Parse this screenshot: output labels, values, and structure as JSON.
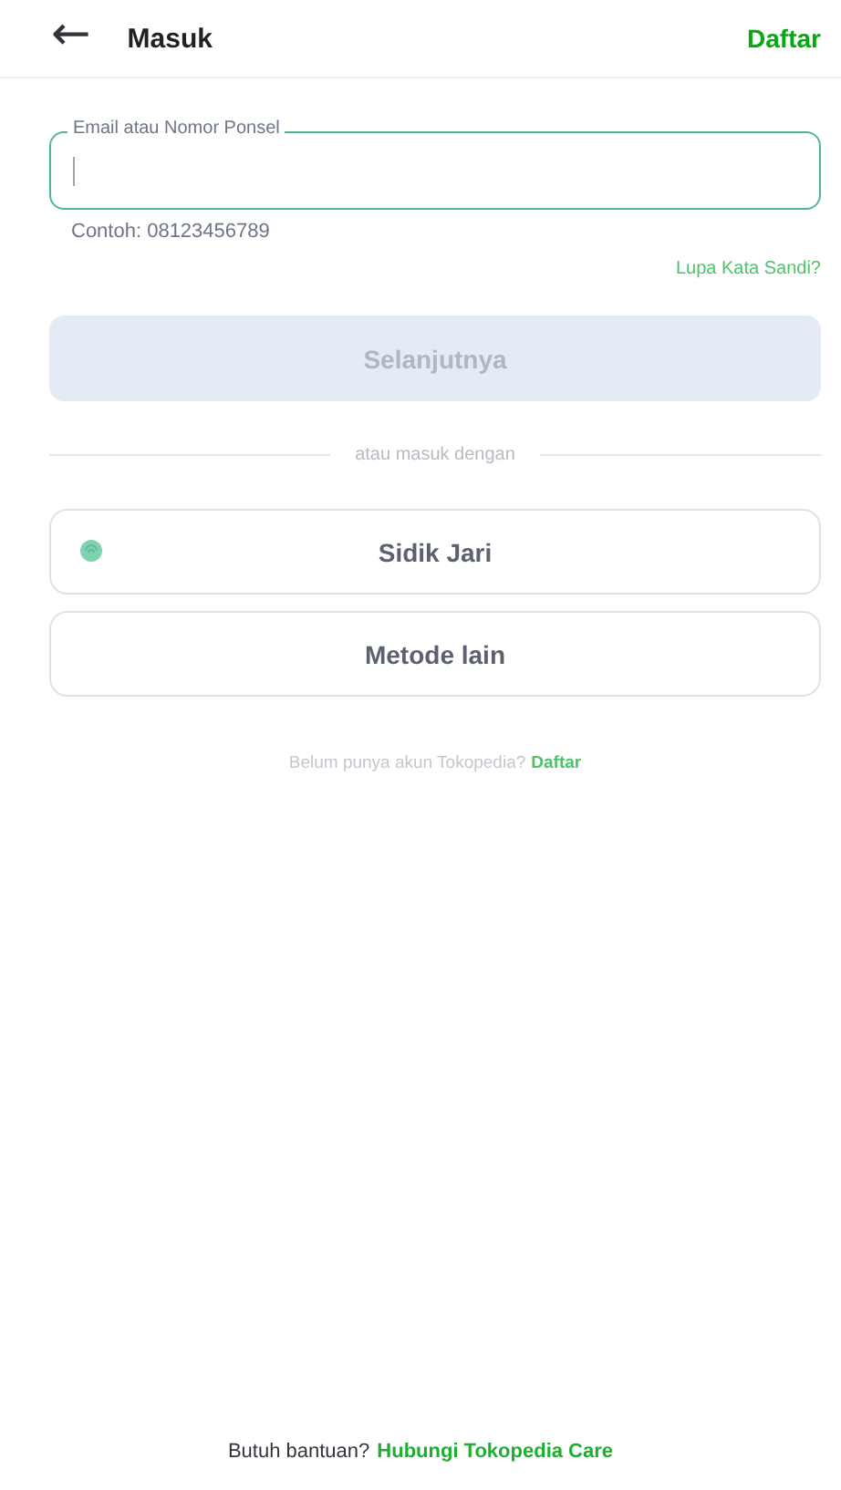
{
  "header": {
    "back": "←",
    "title": "Masuk",
    "action": "Daftar"
  },
  "field": {
    "label": "Email atau Nomor Ponsel",
    "focused": true,
    "hint": "Contoh: 08123456789"
  },
  "forgot": "Lupa Kata Sandi?",
  "submit": {
    "label": "Selanjutnya",
    "disabled": true
  },
  "divider": "atau masuk dengan",
  "methods": [
    {
      "kind": "fingerprint",
      "label": "Sidik Jari"
    },
    {
      "kind": "plain",
      "label": "Metode lain"
    }
  ],
  "register": {
    "prompt": "Belum punya akun Tokopedia?",
    "link": "Daftar"
  },
  "help": {
    "prompt": "Butuh bantuan?",
    "link": "Hubungi Tokopedia Care"
  }
}
